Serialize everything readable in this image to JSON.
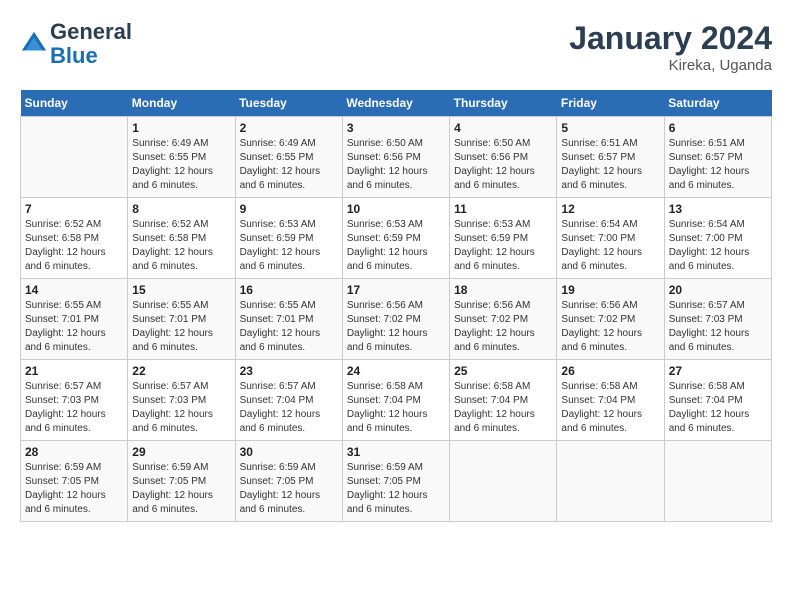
{
  "header": {
    "logo_line1": "General",
    "logo_line2": "Blue",
    "month_year": "January 2024",
    "location": "Kireka, Uganda"
  },
  "days_of_week": [
    "Sunday",
    "Monday",
    "Tuesday",
    "Wednesday",
    "Thursday",
    "Friday",
    "Saturday"
  ],
  "weeks": [
    [
      {
        "day": "",
        "info": ""
      },
      {
        "day": "1",
        "info": "Sunrise: 6:49 AM\nSunset: 6:55 PM\nDaylight: 12 hours\nand 6 minutes."
      },
      {
        "day": "2",
        "info": "Sunrise: 6:49 AM\nSunset: 6:55 PM\nDaylight: 12 hours\nand 6 minutes."
      },
      {
        "day": "3",
        "info": "Sunrise: 6:50 AM\nSunset: 6:56 PM\nDaylight: 12 hours\nand 6 minutes."
      },
      {
        "day": "4",
        "info": "Sunrise: 6:50 AM\nSunset: 6:56 PM\nDaylight: 12 hours\nand 6 minutes."
      },
      {
        "day": "5",
        "info": "Sunrise: 6:51 AM\nSunset: 6:57 PM\nDaylight: 12 hours\nand 6 minutes."
      },
      {
        "day": "6",
        "info": "Sunrise: 6:51 AM\nSunset: 6:57 PM\nDaylight: 12 hours\nand 6 minutes."
      }
    ],
    [
      {
        "day": "7",
        "info": "Sunrise: 6:52 AM\nSunset: 6:58 PM\nDaylight: 12 hours\nand 6 minutes."
      },
      {
        "day": "8",
        "info": "Sunrise: 6:52 AM\nSunset: 6:58 PM\nDaylight: 12 hours\nand 6 minutes."
      },
      {
        "day": "9",
        "info": "Sunrise: 6:53 AM\nSunset: 6:59 PM\nDaylight: 12 hours\nand 6 minutes."
      },
      {
        "day": "10",
        "info": "Sunrise: 6:53 AM\nSunset: 6:59 PM\nDaylight: 12 hours\nand 6 minutes."
      },
      {
        "day": "11",
        "info": "Sunrise: 6:53 AM\nSunset: 6:59 PM\nDaylight: 12 hours\nand 6 minutes."
      },
      {
        "day": "12",
        "info": "Sunrise: 6:54 AM\nSunset: 7:00 PM\nDaylight: 12 hours\nand 6 minutes."
      },
      {
        "day": "13",
        "info": "Sunrise: 6:54 AM\nSunset: 7:00 PM\nDaylight: 12 hours\nand 6 minutes."
      }
    ],
    [
      {
        "day": "14",
        "info": "Sunrise: 6:55 AM\nSunset: 7:01 PM\nDaylight: 12 hours\nand 6 minutes."
      },
      {
        "day": "15",
        "info": "Sunrise: 6:55 AM\nSunset: 7:01 PM\nDaylight: 12 hours\nand 6 minutes."
      },
      {
        "day": "16",
        "info": "Sunrise: 6:55 AM\nSunset: 7:01 PM\nDaylight: 12 hours\nand 6 minutes."
      },
      {
        "day": "17",
        "info": "Sunrise: 6:56 AM\nSunset: 7:02 PM\nDaylight: 12 hours\nand 6 minutes."
      },
      {
        "day": "18",
        "info": "Sunrise: 6:56 AM\nSunset: 7:02 PM\nDaylight: 12 hours\nand 6 minutes."
      },
      {
        "day": "19",
        "info": "Sunrise: 6:56 AM\nSunset: 7:02 PM\nDaylight: 12 hours\nand 6 minutes."
      },
      {
        "day": "20",
        "info": "Sunrise: 6:57 AM\nSunset: 7:03 PM\nDaylight: 12 hours\nand 6 minutes."
      }
    ],
    [
      {
        "day": "21",
        "info": "Sunrise: 6:57 AM\nSunset: 7:03 PM\nDaylight: 12 hours\nand 6 minutes."
      },
      {
        "day": "22",
        "info": "Sunrise: 6:57 AM\nSunset: 7:03 PM\nDaylight: 12 hours\nand 6 minutes."
      },
      {
        "day": "23",
        "info": "Sunrise: 6:57 AM\nSunset: 7:04 PM\nDaylight: 12 hours\nand 6 minutes."
      },
      {
        "day": "24",
        "info": "Sunrise: 6:58 AM\nSunset: 7:04 PM\nDaylight: 12 hours\nand 6 minutes."
      },
      {
        "day": "25",
        "info": "Sunrise: 6:58 AM\nSunset: 7:04 PM\nDaylight: 12 hours\nand 6 minutes."
      },
      {
        "day": "26",
        "info": "Sunrise: 6:58 AM\nSunset: 7:04 PM\nDaylight: 12 hours\nand 6 minutes."
      },
      {
        "day": "27",
        "info": "Sunrise: 6:58 AM\nSunset: 7:04 PM\nDaylight: 12 hours\nand 6 minutes."
      }
    ],
    [
      {
        "day": "28",
        "info": "Sunrise: 6:59 AM\nSunset: 7:05 PM\nDaylight: 12 hours\nand 6 minutes."
      },
      {
        "day": "29",
        "info": "Sunrise: 6:59 AM\nSunset: 7:05 PM\nDaylight: 12 hours\nand 6 minutes."
      },
      {
        "day": "30",
        "info": "Sunrise: 6:59 AM\nSunset: 7:05 PM\nDaylight: 12 hours\nand 6 minutes."
      },
      {
        "day": "31",
        "info": "Sunrise: 6:59 AM\nSunset: 7:05 PM\nDaylight: 12 hours\nand 6 minutes."
      },
      {
        "day": "",
        "info": ""
      },
      {
        "day": "",
        "info": ""
      },
      {
        "day": "",
        "info": ""
      }
    ]
  ]
}
